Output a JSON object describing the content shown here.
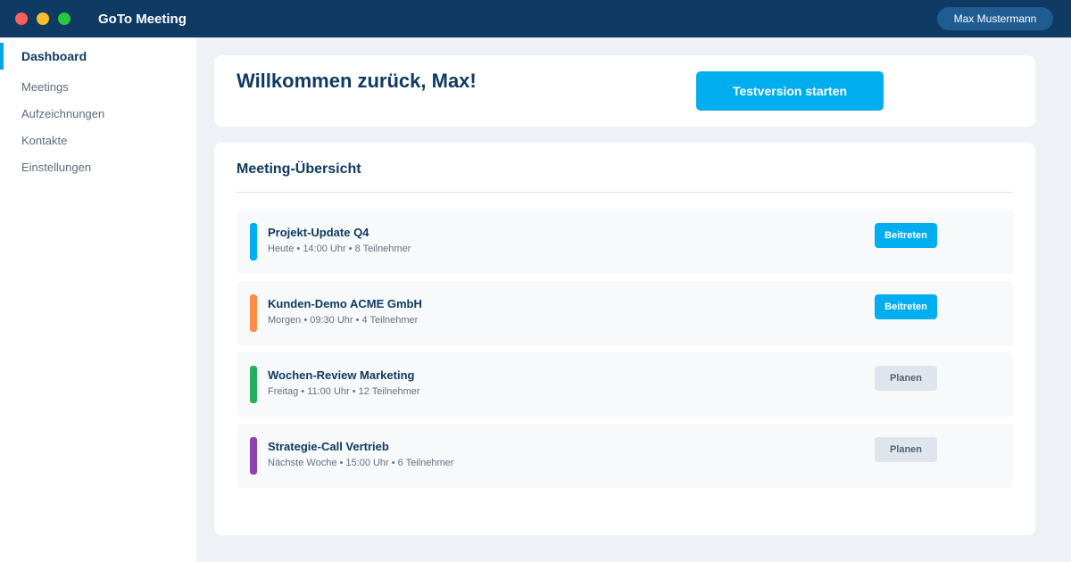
{
  "app": {
    "title": "GoTo Meeting",
    "user_name": "Max Mustermann",
    "colors": {
      "header": "#0f3a63",
      "accent": "#00aef0",
      "background": "#eef2f7"
    }
  },
  "sidebar": {
    "items": [
      {
        "label": "Dashboard",
        "active": true
      },
      {
        "label": "Meetings",
        "active": false
      },
      {
        "label": "Aufzeichnungen",
        "active": false
      },
      {
        "label": "Kontakte",
        "active": false
      },
      {
        "label": "Einstellungen",
        "active": false
      }
    ]
  },
  "welcome": {
    "title": "Willkommen zurück, Max!",
    "trial_button": "Testversion starten"
  },
  "overview": {
    "title": "Meeting-Übersicht",
    "meetings": [
      {
        "name": "Projekt-Update Q4",
        "meta": "Heute • 14:00 Uhr • 8 Teilnehmer",
        "color": "#00aef0",
        "action": "Beitreten",
        "action_type": "join"
      },
      {
        "name": "Kunden-Demo ACME GmbH",
        "meta": "Morgen • 09:30 Uhr • 4 Teilnehmer",
        "color": "#ff8c42",
        "action": "Beitreten",
        "action_type": "join"
      },
      {
        "name": "Wochen-Review Marketing",
        "meta": "Freitag • 11:00 Uhr • 12 Teilnehmer",
        "color": "#22b05a",
        "action": "Planen",
        "action_type": "plan"
      },
      {
        "name": "Strategie-Call Vertrieb",
        "meta": "Nächste Woche • 15:00 Uhr • 6 Teilnehmer",
        "color": "#8e44ad",
        "action": "Planen",
        "action_type": "plan"
      }
    ]
  }
}
